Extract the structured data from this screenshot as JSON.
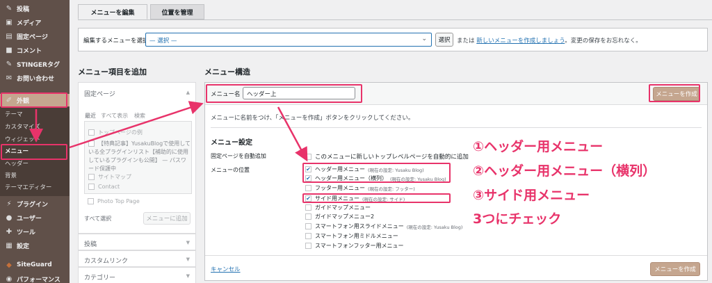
{
  "sidebar": {
    "items": [
      {
        "label": "投稿",
        "icon": "pin-icon"
      },
      {
        "label": "メディア",
        "icon": "media-icon"
      },
      {
        "label": "固定ページ",
        "icon": "page-icon"
      },
      {
        "label": "コメント",
        "icon": "comment-icon"
      },
      {
        "label": "STINGERタグ",
        "icon": "pin-icon"
      },
      {
        "label": "お問い合わせ",
        "icon": "mail-icon"
      },
      {
        "label": "外観",
        "icon": "brush-icon"
      },
      {
        "label": "プラグイン",
        "icon": "plugin-icon"
      },
      {
        "label": "ユーザー",
        "icon": "user-icon"
      },
      {
        "label": "ツール",
        "icon": "wrench-icon"
      },
      {
        "label": "設定",
        "icon": "settings-icon"
      },
      {
        "label": "SiteGuard",
        "icon": "shield-icon"
      },
      {
        "label": "パフォーマンス",
        "icon": "gauge-icon"
      }
    ],
    "submenu": [
      "テーマ",
      "カスタマイズ",
      "ウィジェット",
      "メニュー",
      "ヘッダー",
      "背景",
      "テーマエディター"
    ]
  },
  "tabs": {
    "edit": "メニューを編集",
    "manage": "位置を管理"
  },
  "select_bar": {
    "label": "編集するメニューを選択:",
    "value": "— 選択 —",
    "button": "選択",
    "note_prefix": "または",
    "note_link": "新しいメニューを作成しましょう",
    "note_suffix": "。変更の保存をお忘れなく。"
  },
  "left": {
    "heading": "メニュー項目を追加",
    "pages_title": "固定ページ",
    "mini_tabs": [
      "最近",
      "すべて表示",
      "検索"
    ],
    "page_items": [
      "トップページの例",
      "【特典記事】YusakuBlogで使用している全プラグインリスト【補助的に使用しているプラグインも公開】 — パスワード保護中",
      "サイトマップ",
      "Contact",
      "Photo Top Page"
    ],
    "select_all": "すべて選択",
    "add_button": "メニューに追加",
    "sections": [
      "投稿",
      "カスタムリンク",
      "カテゴリー"
    ]
  },
  "main": {
    "heading": "メニュー構造",
    "name_label": "メニュー名",
    "name_value": "ヘッダー上",
    "create_button": "メニューを作成",
    "help": "メニューに名前をつけ、「メニューを作成」ボタンをクリックしてください。",
    "settings_title": "メニュー設定",
    "auto_add_label": "固定ページを自動追加",
    "auto_add_text": "このメニューに新しいトップレベルページを自動的に追加",
    "location_label": "メニューの位置",
    "locations": [
      {
        "label": "ヘッダー用メニュー",
        "hint": "(現在の設定: Yusaku Blog)",
        "checked": true
      },
      {
        "label": "ヘッダー用メニュー（横列）",
        "hint": "(現在の設定: Yusaku Blog)",
        "checked": true
      },
      {
        "label": "フッター用メニュー",
        "hint": "(現在の設定: フッター)",
        "checked": false
      },
      {
        "label": "サイド用メニュー",
        "hint": "(現在の設定: サイド)",
        "checked": true
      },
      {
        "label": "ガイドマップメニュー",
        "hint": "",
        "checked": false
      },
      {
        "label": "ガイドマップメニュー2",
        "hint": "",
        "checked": false
      },
      {
        "label": "スマートフォン用スライドメニュー",
        "hint": "(現在の設定: Yusaku Blog)",
        "checked": false
      },
      {
        "label": "スマートフォン用ミドルメニュー",
        "hint": "",
        "checked": false
      },
      {
        "label": "スマートフォンフッター用メニュー",
        "hint": "",
        "checked": false
      }
    ],
    "cancel": "キャンセル"
  },
  "annotations": [
    "①ヘッダー用メニュー",
    "②ヘッダー用メニュー（横列）",
    "③サイド用メニュー",
    "3つにチェック"
  ],
  "colors": {
    "sidebar": "#605049",
    "accent": "#c5a68f",
    "highlight": "#e8336a",
    "link": "#2271b1"
  }
}
